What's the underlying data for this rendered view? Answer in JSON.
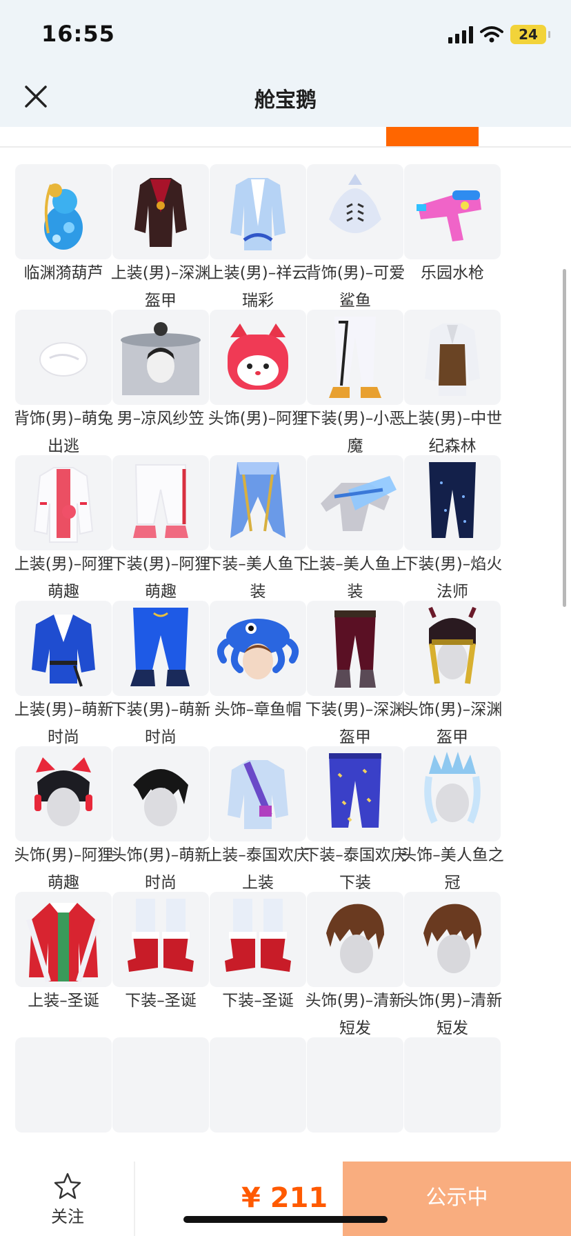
{
  "status_bar": {
    "time": "16:55",
    "battery": "24"
  },
  "nav": {
    "title": "舱宝鹅",
    "close_icon": "close-icon"
  },
  "colors": {
    "accent": "#ff6600",
    "price": "#ff5a00",
    "button": "#f9ad7f"
  },
  "items": [
    {
      "name": "临渊漪葫芦",
      "icon": "gourd-icon"
    },
    {
      "name": "上装(男)–深渊盔甲",
      "icon": "armor-top-icon"
    },
    {
      "name": "上装(男)–祥云瑞彩",
      "icon": "cloud-top-icon"
    },
    {
      "name": "背饰(男)–可爱鲨鱼",
      "icon": "shark-backpack-icon"
    },
    {
      "name": "乐园水枪",
      "icon": "water-gun-icon"
    },
    {
      "name": "背饰(男)–萌兔出逃",
      "icon": "bunny-tail-icon"
    },
    {
      "name": "男–凉风纱笠",
      "icon": "veil-hat-icon"
    },
    {
      "name": "头饰(男)–阿狸",
      "icon": "ali-fox-head-icon"
    },
    {
      "name": "下装(男)–小恶魔",
      "icon": "white-pants-icon"
    },
    {
      "name": "上装(男)–中世纪森林",
      "icon": "forest-top-icon"
    },
    {
      "name": "上装(男)–阿狸萌趣",
      "icon": "ali-hoodie-icon"
    },
    {
      "name": "下装(男)–阿狸萌趣",
      "icon": "ali-pants-icon"
    },
    {
      "name": "下装–美人鱼下装",
      "icon": "mermaid-bottom-icon"
    },
    {
      "name": "上装–美人鱼上装",
      "icon": "mermaid-top-icon"
    },
    {
      "name": "下装(男)–焰火法师",
      "icon": "mage-pants-icon"
    },
    {
      "name": "上装(男)–萌新时尚",
      "icon": "blue-top-icon"
    },
    {
      "name": "下装(男)–萌新时尚",
      "icon": "blue-pants-icon"
    },
    {
      "name": "头饰–章鱼帽",
      "icon": "octopus-hat-icon"
    },
    {
      "name": "下装(男)–深渊盔甲",
      "icon": "armor-pants-icon"
    },
    {
      "name": "头饰(男)–深渊盔甲",
      "icon": "armor-helmet-icon"
    },
    {
      "name": "头饰(男)–阿狸萌趣",
      "icon": "fox-ear-hair-icon"
    },
    {
      "name": "头饰(男)–萌新时尚",
      "icon": "black-hair-icon"
    },
    {
      "name": "上装–泰国欢庆上装",
      "icon": "thai-top-icon"
    },
    {
      "name": "下装–泰国欢庆下装",
      "icon": "thai-pants-icon"
    },
    {
      "name": "头饰–美人鱼之冠",
      "icon": "mermaid-crown-icon"
    },
    {
      "name": "上装–圣诞",
      "icon": "christmas-coat-icon"
    },
    {
      "name": "下装–圣诞",
      "icon": "christmas-boots-icon"
    },
    {
      "name": "下装–圣诞",
      "icon": "christmas-boots-icon"
    },
    {
      "name": "头饰(男)–清新短发",
      "icon": "brown-hair-icon"
    },
    {
      "name": "头饰(男)–清新短发",
      "icon": "brown-hair-icon"
    }
  ],
  "bottom": {
    "follow_label": "关注",
    "follow_icon": "star-icon",
    "price": "¥ 211",
    "button_label": "公示中"
  }
}
